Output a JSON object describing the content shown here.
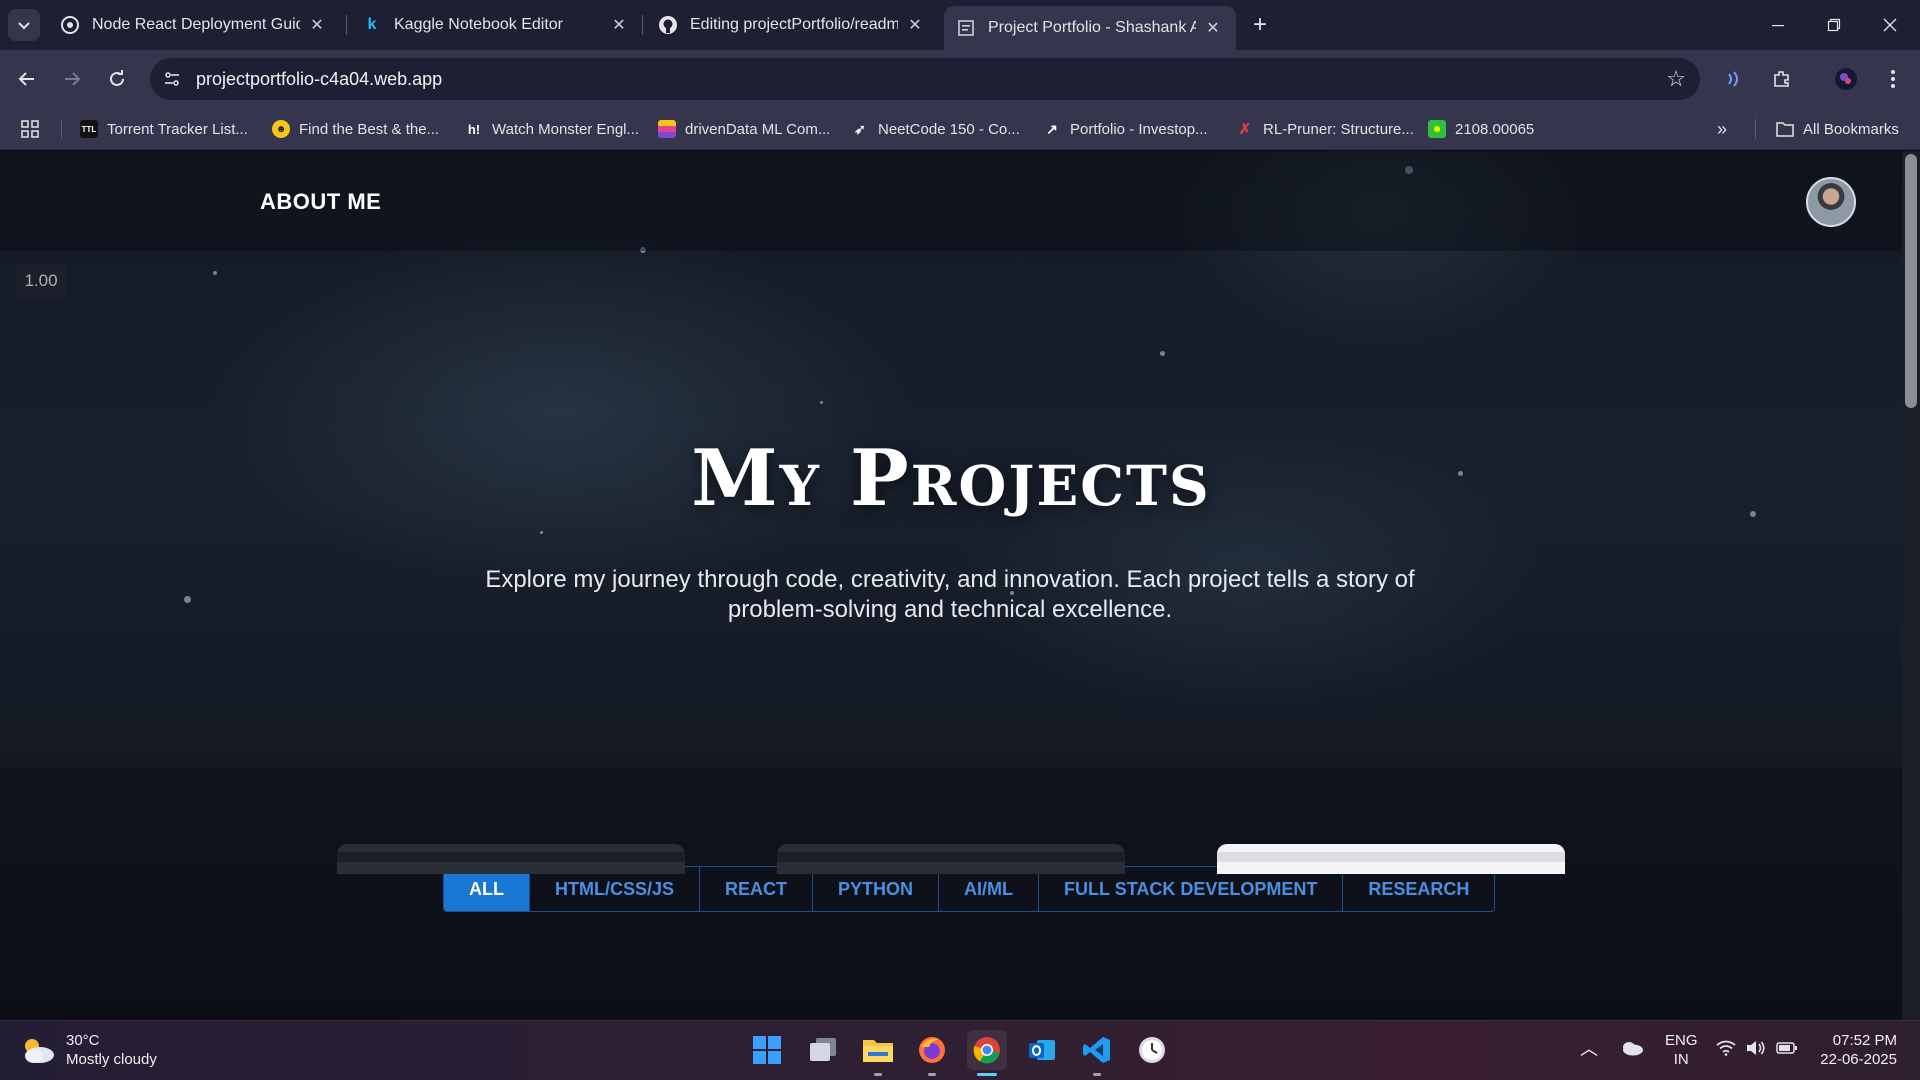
{
  "browser": {
    "tabs": [
      {
        "title": "Node React Deployment Guide",
        "icon": "openai-icon"
      },
      {
        "title": "Kaggle Notebook Editor",
        "icon": "kaggle-icon"
      },
      {
        "title": "Editing projectPortfolio/readme",
        "icon": "github-icon"
      },
      {
        "title": "Project Portfolio - Shashank Ag",
        "icon": "page-icon",
        "active": true
      }
    ],
    "url": "projectportfolio-c4a04.web.app",
    "bookmarks": [
      {
        "label": "Torrent Tracker List...",
        "icon": "ttl-icon"
      },
      {
        "label": "Find the Best & the...",
        "icon": "smiley-icon"
      },
      {
        "label": "Watch Monster Engl...",
        "icon": "h-icon"
      },
      {
        "label": "drivenData ML Com...",
        "icon": "drivendata-icon"
      },
      {
        "label": "NeetCode 150 - Co...",
        "icon": "rocket-icon"
      },
      {
        "label": "Portfolio - Investop...",
        "icon": "investopedia-icon"
      },
      {
        "label": "RL-Pruner: Structure...",
        "icon": "arxiv-icon"
      },
      {
        "label": "2108.00065",
        "icon": "green-smiley-icon"
      }
    ],
    "all_bookmarks_label": "All Bookmarks"
  },
  "page": {
    "nav": {
      "about_label": "ABOUT ME"
    },
    "zoom_label": "1.00",
    "hero": {
      "title": "My Projects",
      "subtitle": "Explore my journey through code, creativity, and innovation. Each project tells a story of problem-solving and technical excellence."
    },
    "filters": [
      "ALL",
      "HTML/CSS/JS",
      "REACT",
      "PYTHON",
      "AI/ML",
      "FULL STACK DEVELOPMENT",
      "RESEARCH"
    ],
    "active_filter": "ALL",
    "accent_color": "#1976d2"
  },
  "taskbar": {
    "weather": {
      "temp": "30°C",
      "condition": "Mostly cloudy"
    },
    "language": {
      "lang": "ENG",
      "region": "IN"
    },
    "clock": {
      "time": "07:52 PM",
      "date": "22-06-2025"
    }
  }
}
